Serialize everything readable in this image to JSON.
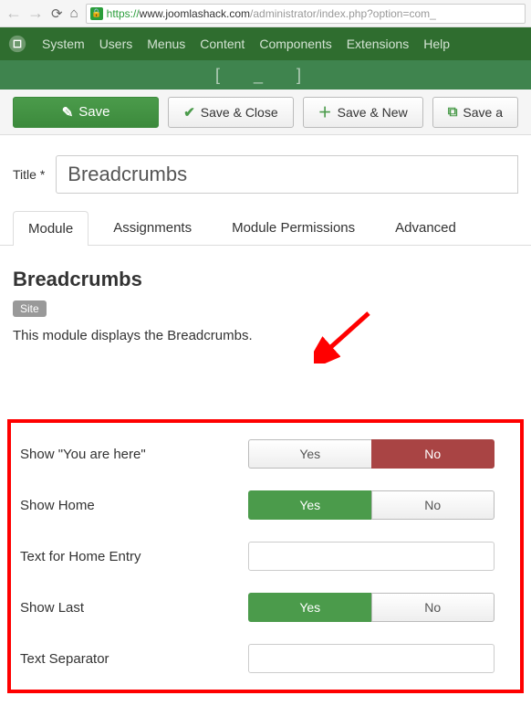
{
  "browser": {
    "url_protocol": "https://",
    "url_host": "www.joomlashack.com",
    "url_path": "/administrator/index.php?option=com_"
  },
  "topmenu": {
    "items": [
      "System",
      "Users",
      "Menus",
      "Content",
      "Components",
      "Extensions",
      "Help"
    ]
  },
  "toolbar": {
    "save": "Save",
    "save_close": "Save & Close",
    "save_new": "Save & New",
    "save_copy": "Save a"
  },
  "title": {
    "label": "Title *",
    "value": "Breadcrumbs"
  },
  "tabs": {
    "items": [
      "Module",
      "Assignments",
      "Module Permissions",
      "Advanced"
    ],
    "active": 0
  },
  "module": {
    "heading": "Breadcrumbs",
    "badge": "Site",
    "description": "This module displays the Breadcrumbs.",
    "fields": [
      {
        "label": "Show \"You are here\"",
        "type": "toggle",
        "yes": "Yes",
        "no": "No",
        "value": "No"
      },
      {
        "label": "Show Home",
        "type": "toggle",
        "yes": "Yes",
        "no": "No",
        "value": "Yes"
      },
      {
        "label": "Text for Home Entry",
        "type": "text",
        "value": ""
      },
      {
        "label": "Show Last",
        "type": "toggle",
        "yes": "Yes",
        "no": "No",
        "value": "Yes"
      },
      {
        "label": "Text Separator",
        "type": "text",
        "value": ""
      }
    ]
  }
}
